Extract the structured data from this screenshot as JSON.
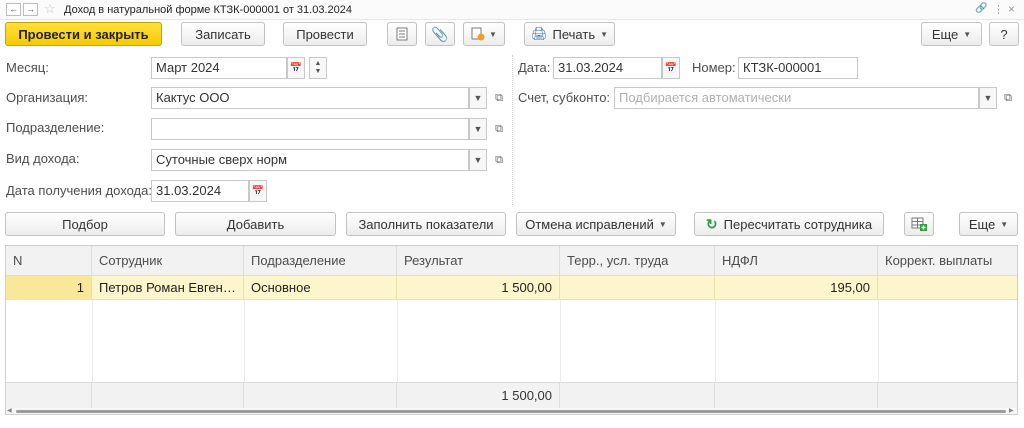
{
  "window": {
    "title": "Доход в натуральной форме КТЗК-000001 от 31.03.2024"
  },
  "toolbar": {
    "post_close": "Провести и закрыть",
    "save": "Записать",
    "post": "Провести",
    "print": "Печать",
    "more": "Еще",
    "help": "?"
  },
  "form": {
    "month_label": "Месяц:",
    "month_value": "Март 2024",
    "org_label": "Организация:",
    "org_value": "Кактус ООО",
    "dept_label": "Подразделение:",
    "dept_value": "",
    "income_type_label": "Вид дохода:",
    "income_type_value": "Суточные сверх норм",
    "income_date_label": "Дата получения дохода:",
    "income_date_value": "31.03.2024",
    "date_label": "Дата:",
    "date_value": "31.03.2024",
    "number_label": "Номер:",
    "number_value": "КТЗК-000001",
    "account_label": "Счет, субконто:",
    "account_placeholder": "Подбирается автоматически"
  },
  "table_toolbar": {
    "select": "Подбор",
    "add": "Добавить",
    "fill": "Заполнить показатели",
    "cancel_corrections": "Отмена исправлений",
    "recalc": "Пересчитать сотрудника",
    "more": "Еще"
  },
  "table": {
    "headers": [
      "N",
      "Сотрудник",
      "Подразделение",
      "Результат",
      "Терр., усл. труда",
      "НДФЛ",
      "Коррект. выплаты"
    ],
    "rows": [
      {
        "n": "1",
        "employee": "Петров Роман Евгеньевич",
        "dept": "Основное",
        "result": "1 500,00",
        "territory": "",
        "ndfl": "195,00",
        "correction": ""
      }
    ],
    "footer_result": "1 500,00"
  }
}
